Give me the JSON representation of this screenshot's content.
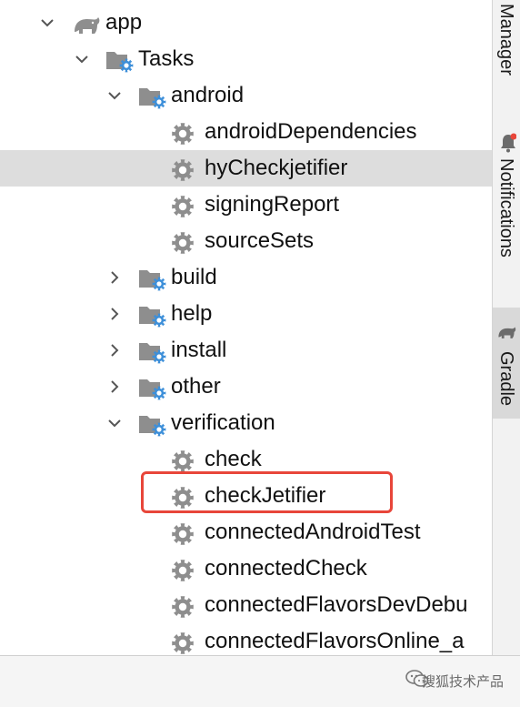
{
  "tree": [
    {
      "label": "app",
      "kind": "root",
      "depth": 0,
      "expanded": true
    },
    {
      "label": "Tasks",
      "kind": "folder",
      "depth": 1,
      "expanded": true
    },
    {
      "label": "android",
      "kind": "folder",
      "depth": 2,
      "expanded": true
    },
    {
      "label": "androidDependencies",
      "kind": "task",
      "depth": 3
    },
    {
      "label": "hyCheckjetifier",
      "kind": "task",
      "depth": 3,
      "selected": true
    },
    {
      "label": "signingReport",
      "kind": "task",
      "depth": 3
    },
    {
      "label": "sourceSets",
      "kind": "task",
      "depth": 3
    },
    {
      "label": "build",
      "kind": "folder",
      "depth": 2,
      "expanded": false
    },
    {
      "label": "help",
      "kind": "folder",
      "depth": 2,
      "expanded": false
    },
    {
      "label": "install",
      "kind": "folder",
      "depth": 2,
      "expanded": false
    },
    {
      "label": "other",
      "kind": "folder",
      "depth": 2,
      "expanded": false
    },
    {
      "label": "verification",
      "kind": "folder",
      "depth": 2,
      "expanded": true
    },
    {
      "label": "check",
      "kind": "task",
      "depth": 3
    },
    {
      "label": "checkJetifier",
      "kind": "task",
      "depth": 3,
      "highlighted": true
    },
    {
      "label": "connectedAndroidTest",
      "kind": "task",
      "depth": 3
    },
    {
      "label": "connectedCheck",
      "kind": "task",
      "depth": 3
    },
    {
      "label": "connectedFlavorsDevDebu",
      "kind": "task",
      "depth": 3
    },
    {
      "label": "connectedFlavorsOnline_a",
      "kind": "task",
      "depth": 3
    }
  ],
  "sidebar": {
    "manager_label": "Manager",
    "notifications_label": "Notifications",
    "gradle_label": "Gradle"
  },
  "footer": {
    "watermark": "搜狐技术产品"
  },
  "colors": {
    "highlight": "#e8463a",
    "selected_row": "#dddddd",
    "icon_gray": "#8e8e8e",
    "icon_blue": "#3d8fd9"
  },
  "icons": {
    "expanded": "chevron-down-icon",
    "collapsed": "chevron-right-icon",
    "root": "gradle-elephant-icon",
    "folder": "task-folder-icon",
    "task": "gear-icon"
  }
}
